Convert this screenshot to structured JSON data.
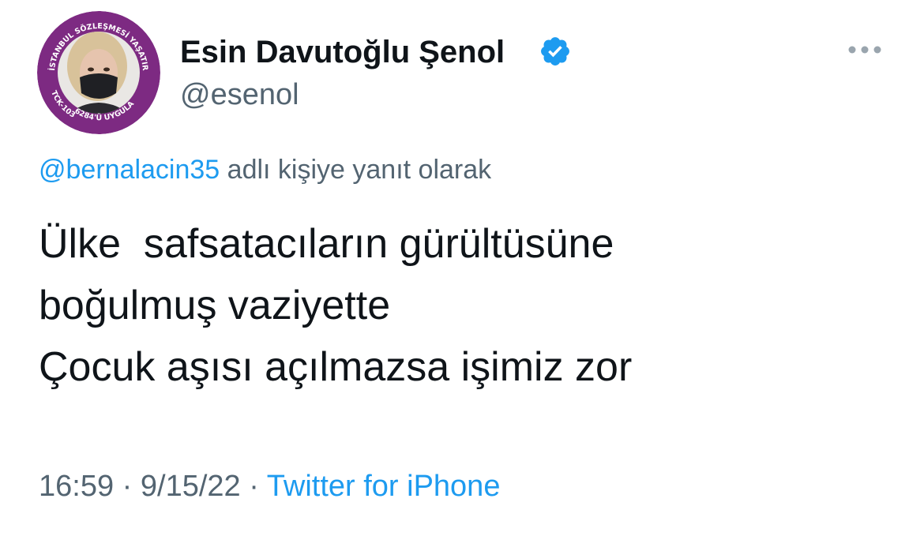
{
  "tweet": {
    "author": {
      "display_name": "Esin Davutoğlu Şenol",
      "handle": "@esenol",
      "verified": true,
      "avatar": {
        "ring_color": "#7d2a82",
        "ring_text_top": "İSTANBUL SÖZLEŞMESİ YAŞATIR",
        "ring_text_left": "TCK-103",
        "ring_text_bottom": "6284'Ü UYGULA"
      }
    },
    "reply_to": {
      "handle": "@bernalacin35",
      "suffix": " adlı kişiye yanıt olarak"
    },
    "text_lines": [
      "Ülke  safsatacıların gürültüsüne",
      "boğulmuş vaziyette",
      "Çocuk aşısı açılmazsa işimiz zor"
    ],
    "time": "16:59",
    "separator": " · ",
    "date": "9/15/22",
    "source": "Twitter for iPhone"
  },
  "icons": {
    "verified": "verified-badge-icon",
    "more": "more-dots-icon"
  },
  "colors": {
    "accent": "#1d9bf0",
    "secondary_text": "#536471",
    "primary_text": "#0f1419",
    "avatar_ring": "#7d2a82"
  }
}
